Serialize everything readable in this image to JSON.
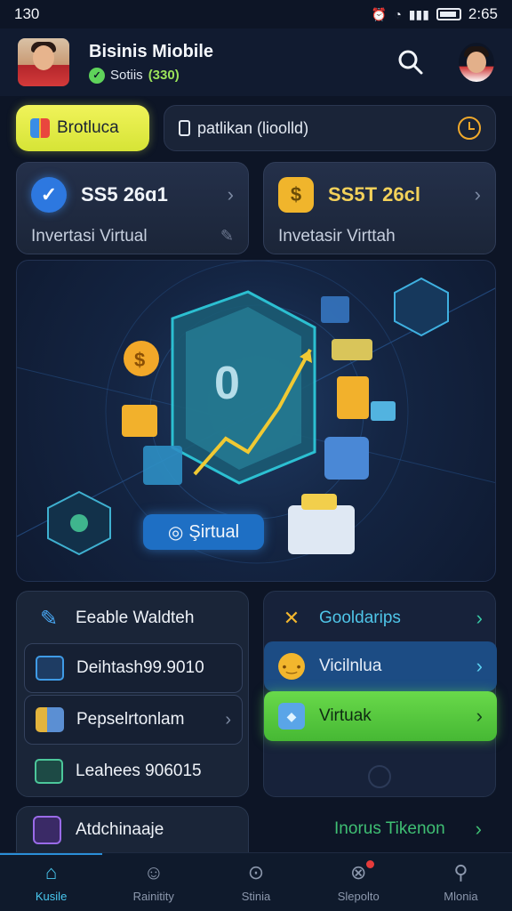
{
  "status_bar": {
    "left_text": "130",
    "time": "2:65"
  },
  "header": {
    "title": "Bisinis Miobile",
    "subtitle_label": "Sotiis",
    "subtitle_value": "(330)"
  },
  "chips": {
    "primary_label": "Brotluca",
    "search_text": "patlikan (lioolld)"
  },
  "stats": [
    {
      "value": "SS5 26ɑ1",
      "label": "Invertasi Virtual"
    },
    {
      "value": "SS5T 26cl",
      "label": "Invetasir Virttah"
    }
  ],
  "hero": {
    "badge_label": "Şirtual"
  },
  "left_list": [
    {
      "label": "Eeable Waldteh"
    },
    {
      "label": "Deihtash99.9010"
    },
    {
      "label": "Pepselrtonlam"
    },
    {
      "label": "Leahees 906015"
    }
  ],
  "right_list": [
    {
      "label": "Gooldarips"
    },
    {
      "label": "Vicilnlua"
    },
    {
      "label": "Virtuak"
    }
  ],
  "bottom": {
    "left_label": "Atdchinaaje",
    "right_label": "Inorus Tikenon"
  },
  "tabs": [
    {
      "label": "Kusile",
      "icon": "home-icon"
    },
    {
      "label": "Rainitity",
      "icon": "users-icon"
    },
    {
      "label": "Stinia",
      "icon": "search-tab-icon"
    },
    {
      "label": "Slepolto",
      "icon": "close-circle-icon"
    },
    {
      "label": "Mlonia",
      "icon": "magnifier-icon"
    }
  ],
  "colors": {
    "accent_blue": "#2d78e0",
    "accent_green": "#5fd35a",
    "accent_gold": "#f0b52c",
    "background": "#0d1526"
  }
}
